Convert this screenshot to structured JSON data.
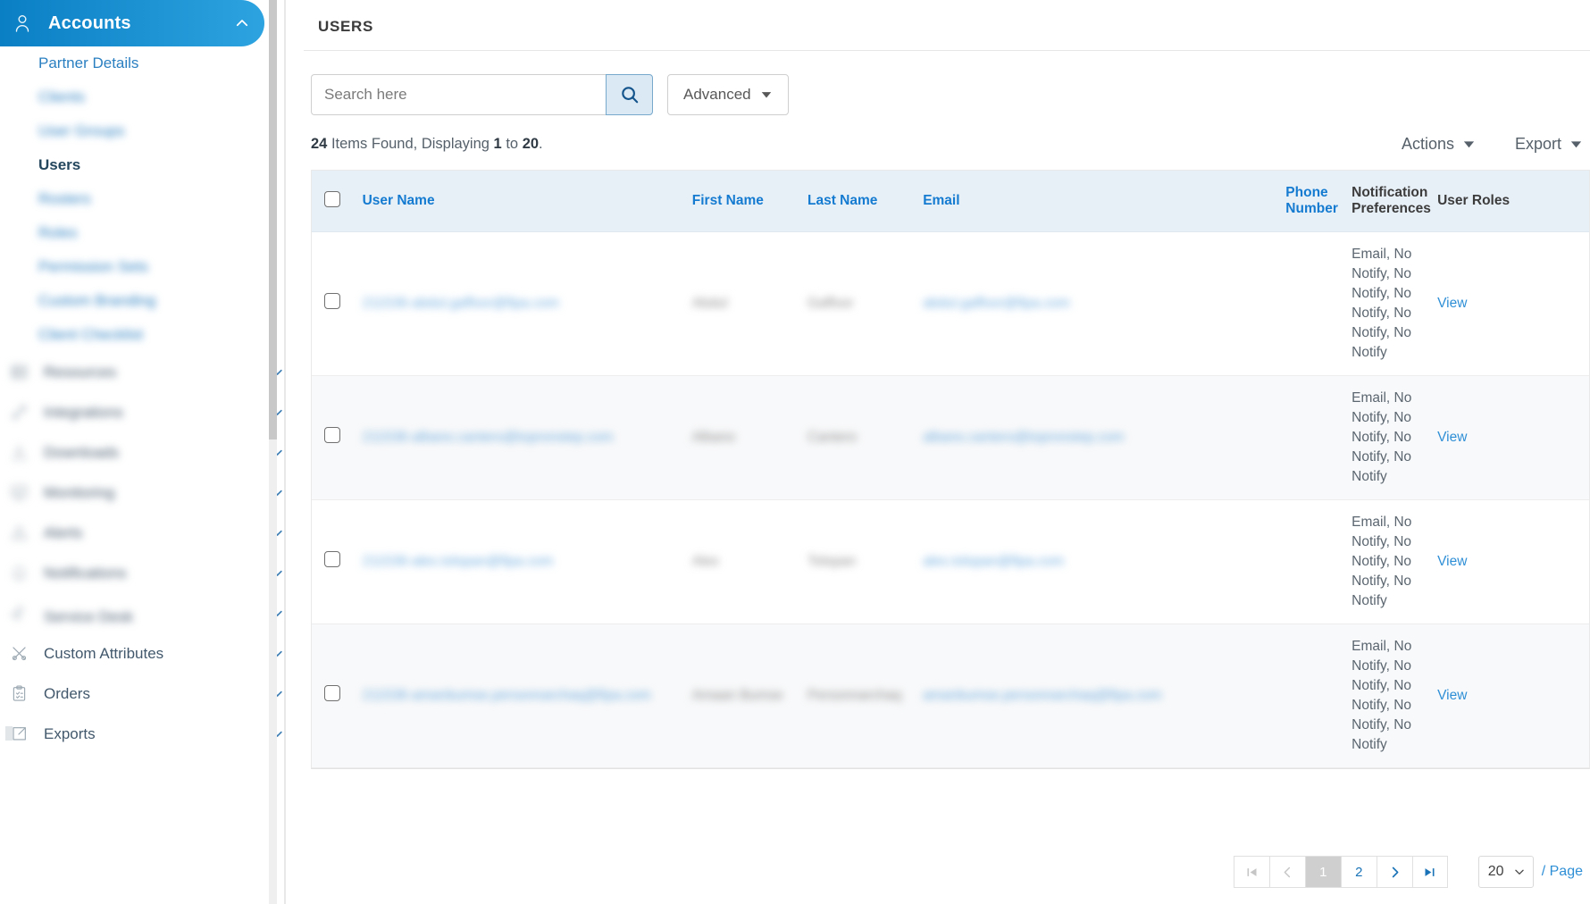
{
  "sidebar": {
    "account_section": {
      "label": "Accounts",
      "icon": "user-icon",
      "chevron": "chevron-up-icon",
      "expanded": true,
      "accent_start": "#0a7fc4",
      "accent_end": "#2da3e0"
    },
    "sub_items": [
      {
        "label": "Partner Details",
        "state": "link",
        "redacted": false
      },
      {
        "label": "Clients",
        "state": "link",
        "redacted": true
      },
      {
        "label": "User Groups",
        "state": "link",
        "redacted": true
      },
      {
        "label": "Users",
        "state": "current",
        "redacted": false
      },
      {
        "label": "Rosters",
        "state": "link",
        "redacted": true
      },
      {
        "label": "Roles",
        "state": "link",
        "redacted": true
      },
      {
        "label": "Permission Sets",
        "state": "link",
        "redacted": true
      },
      {
        "label": "Custom Branding",
        "state": "link",
        "redacted": true
      },
      {
        "label": "Client Checklist",
        "state": "link",
        "redacted": true
      }
    ],
    "nav_items": [
      {
        "label": "Resources",
        "icon": "server-icon",
        "chevron": "chevron-down-icon",
        "redacted": true
      },
      {
        "label": "Integrations",
        "icon": "plug-icon",
        "chevron": "chevron-down-icon",
        "redacted": true
      },
      {
        "label": "Downloads",
        "icon": "download-icon",
        "chevron": "chevron-down-icon",
        "redacted": true
      },
      {
        "label": "Monitoring",
        "icon": "monitor-chart-icon",
        "chevron": "chevron-down-icon",
        "redacted": true
      },
      {
        "label": "Alerts",
        "icon": "warning-triangle-icon",
        "chevron": "chevron-down-icon",
        "redacted": true
      },
      {
        "label": "Notifications",
        "icon": "bell-icon",
        "chevron": "chevron-down-icon",
        "redacted": true
      },
      {
        "label": "Service Desk",
        "icon": "hand-gear-icon",
        "chevron": "chevron-down-icon",
        "redacted": false
      },
      {
        "label": "Custom Attributes",
        "icon": "scissors-icon",
        "chevron": "chevron-down-icon",
        "redacted": false
      },
      {
        "label": "Orders",
        "icon": "clipboard-check-icon",
        "chevron": "chevron-down-icon",
        "redacted": false
      },
      {
        "label": "Exports",
        "icon": "export-icon",
        "chevron": "chevron-down-icon",
        "redacted": false
      }
    ]
  },
  "page": {
    "title": "USERS"
  },
  "search": {
    "placeholder": "Search here",
    "value": "",
    "button_icon": "search-icon",
    "advanced_label": "Advanced",
    "advanced_chevron": "chevron-down-icon"
  },
  "results": {
    "count": "24",
    "found_text": "Items Found, Displaying",
    "from": "1",
    "to_text": "to",
    "to": "20",
    "period": "."
  },
  "toolbar": {
    "actions_label": "Actions",
    "export_label": "Export"
  },
  "table": {
    "columns": [
      {
        "key": "chk",
        "label": "",
        "link": false
      },
      {
        "key": "user",
        "label": "User Name",
        "link": true
      },
      {
        "key": "first",
        "label": "First Name",
        "link": true
      },
      {
        "key": "last",
        "label": "Last Name",
        "link": true
      },
      {
        "key": "email",
        "label": "Email",
        "link": true
      },
      {
        "key": "phone",
        "label": "Phone Number",
        "link": true
      },
      {
        "key": "notif",
        "label": "Notification Preferences",
        "link": false
      },
      {
        "key": "roles",
        "label": "User Roles",
        "link": false
      },
      {
        "key": "view",
        "label": "",
        "link": false
      }
    ],
    "rows": [
      {
        "user": "211536-abdul.gaffoor@fipa.com",
        "first": "Abdul",
        "last": "Gaffoor",
        "email": "abdul.gaffoor@fipa.com",
        "phone": "",
        "notif": "Email, No Notify, No Notify, No Notify, No Notify, No Notify",
        "roles": "",
        "view": "View"
      },
      {
        "user": "211536-albano.cantero@topronstep.com",
        "first": "Albano",
        "last": "Cantero",
        "email": "albano.cantero@topronstep.com",
        "phone": "",
        "notif": "Email, No Notify, No Notify, No Notify, No Notify",
        "roles": "",
        "view": "View"
      },
      {
        "user": "211536-alex.tolopan@fipa.com",
        "first": "Alex",
        "last": "Tolopan",
        "email": "alex.tolopan@fipa.com",
        "phone": "",
        "notif": "Email, No Notify, No Notify, No Notify, No Notify",
        "roles": "",
        "view": "View"
      },
      {
        "user": "211536-amanbumse.personnarchaq@fipa.com",
        "first": "Amaan Bumse",
        "last": "Personnarchaq",
        "email": "amanbumse.personnarchaq@fipa.com",
        "phone": "",
        "notif": "Email, No Notify, No Notify, No Notify, No Notify, No Notify",
        "roles": "",
        "view": "View"
      }
    ]
  },
  "pagination": {
    "first_icon": "page-first-icon",
    "prev_icon": "chevron-left-icon",
    "next_icon": "chevron-right-icon",
    "last_icon": "page-last-icon",
    "pages": [
      "1",
      "2"
    ],
    "active_page": "1",
    "page_size": "20",
    "per_page_label": "/ Page"
  }
}
